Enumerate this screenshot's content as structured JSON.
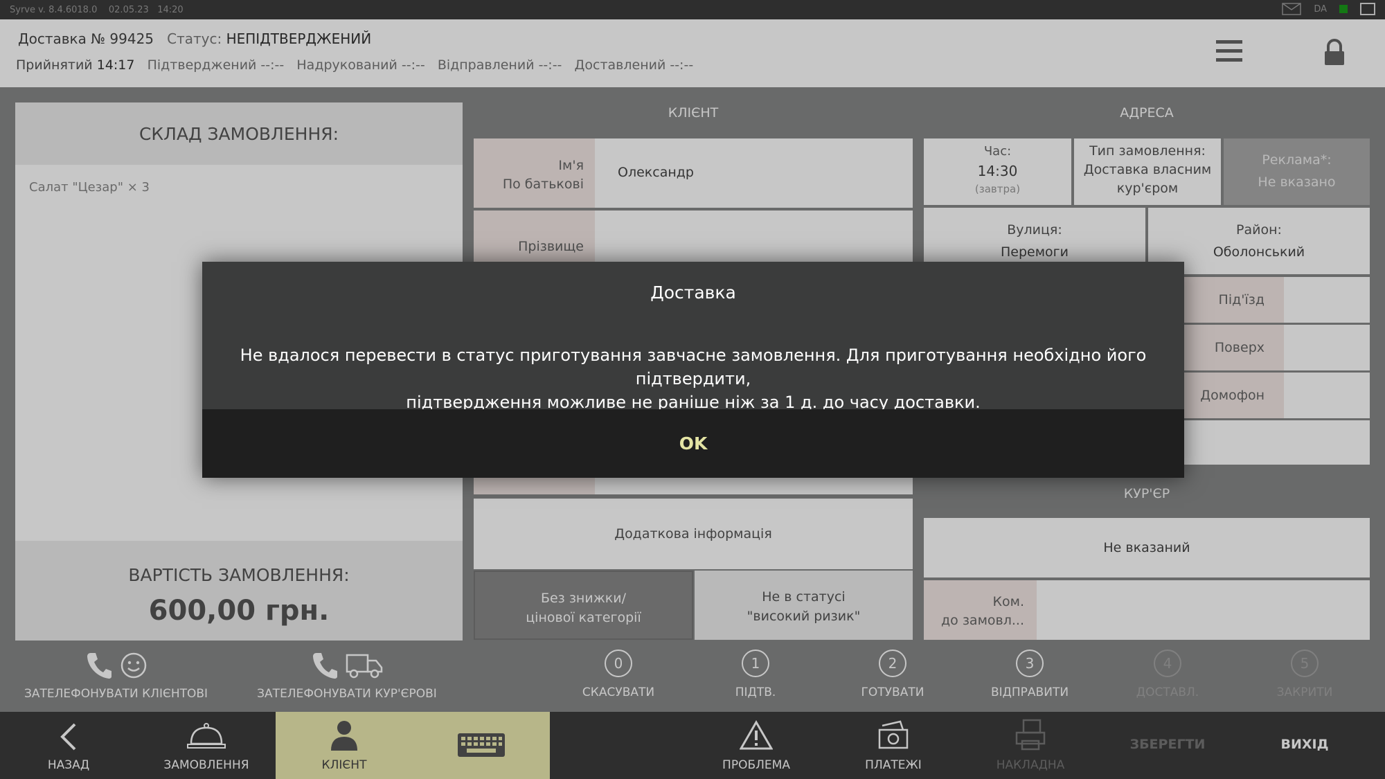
{
  "topbar": {
    "version": "Syrve v. 8.4.6018.0",
    "date": "02.05.23",
    "time": "14:20",
    "user": "DA"
  },
  "header": {
    "delivery_label": "Доставка № 99425",
    "status_label": "Статус:",
    "status_value": "НЕПІДТВЕРДЖЕНИЙ",
    "accepted_label": "Прийнятий",
    "accepted_time": "14:17",
    "confirmed": "Підтверджений --:--",
    "printed": "Надрукований --:--",
    "sent": "Відправлений --:--",
    "delivered": "Доставлений --:--"
  },
  "order": {
    "title": "СКЛАД ЗАМОВЛЕННЯ:",
    "items": [
      "Салат \"Цезар\" × 3"
    ],
    "cost_label": "ВАРТІСТЬ ЗАМОВЛЕННЯ:",
    "cost_value": "600,00 грн."
  },
  "client": {
    "title": "КЛІЄНТ",
    "name_label_1": "Ім'я",
    "name_label_2": "По батькові",
    "name_value": "Олександр",
    "surname_label": "Прізвище",
    "surname_value": "",
    "extra_info": "Додаткова інформація",
    "discount_1": "Без знижки/",
    "discount_2": "цінової категорії",
    "risk_1": "Не в статусі",
    "risk_2": "\"високий ризик\""
  },
  "address": {
    "title": "АДРЕСА",
    "time_label": "Час:",
    "time_value": "14:30",
    "time_note": "(завтра)",
    "order_type_label": "Тип замовлення:",
    "order_type_1": "Доставка власним",
    "order_type_2": "кур'єром",
    "ad_label": "Реклама*:",
    "ad_value": "Не вказано",
    "street_label": "Вулиця:",
    "street_value": "Перемоги",
    "district_label": "Район:",
    "district_value": "Оболонський",
    "entrance_label": "Під'їзд",
    "floor_label": "Поверх",
    "intercom_label": "Домофон"
  },
  "courier": {
    "title": "КУР'ЄР",
    "value": "Не вказаний",
    "comment_1": "Ком.",
    "comment_2": "до замовл..."
  },
  "actions": {
    "call_client": "ЗАТЕЛЕФОНУВАТИ КЛІЄНТОВІ",
    "call_courier": "ЗАТЕЛЕФОНУВАТИ КУР'ЄРОВІ",
    "steps": [
      {
        "num": "0",
        "label": "СКАСУВАТИ"
      },
      {
        "num": "1",
        "label": "ПІДТВ."
      },
      {
        "num": "2",
        "label": "ГОТУВАТИ"
      },
      {
        "num": "3",
        "label": "ВІДПРАВИТИ"
      },
      {
        "num": "4",
        "label": "ДОСТАВЛ."
      },
      {
        "num": "5",
        "label": "ЗАКРИТИ"
      }
    ]
  },
  "nav": {
    "back": "НАЗАД",
    "orders": "ЗАМОВЛЕННЯ",
    "client": "КЛІЄНТ",
    "problem": "ПРОБЛЕМА",
    "payments": "ПЛАТЕЖІ",
    "invoice": "НАКЛАДНА",
    "save": "ЗБЕРЕГТИ",
    "exit": "ВИХІД"
  },
  "dialog": {
    "title": "Доставка",
    "line1": "Не вдалося перевести в статус приготування завчасне замовлення. Для приготування необхідно його підтвердити,",
    "line2": "підтвердження можливе не раніше ніж за 1 д. до часу доставки.",
    "ok": "OK"
  }
}
